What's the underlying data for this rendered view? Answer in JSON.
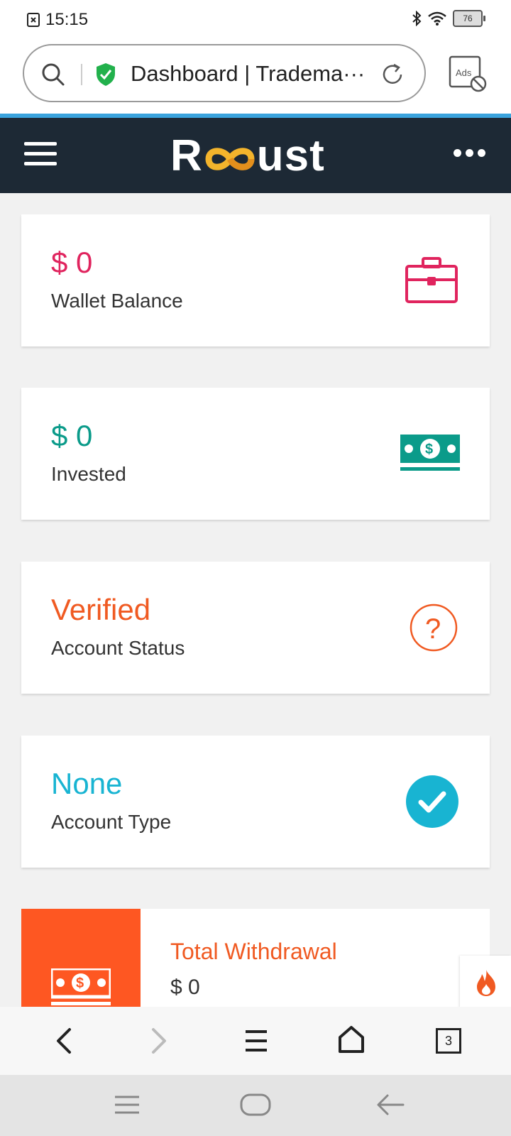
{
  "status_bar": {
    "time": "15:15",
    "battery": "76"
  },
  "browser": {
    "url_text": "Dashboard | Tradema···",
    "ads_label": "Ads",
    "tab_count": "3"
  },
  "site": {
    "logo_text_left": "R",
    "logo_text_right": "ust"
  },
  "cards": [
    {
      "value": "$ 0",
      "label": "Wallet Balance",
      "color": "#e0245e",
      "icon": "briefcase-icon"
    },
    {
      "value": "$ 0",
      "label": "Invested",
      "color": "#0b9b8a",
      "icon": "money-icon"
    },
    {
      "value": "Verified",
      "label": "Account Status",
      "color": "#f05a22",
      "icon": "question-circle-icon"
    },
    {
      "value": "None",
      "label": "Account Type",
      "color": "#18b4d2",
      "icon": "check-circle-icon"
    }
  ],
  "withdrawal": {
    "title": "Total Withdrawal",
    "value": "$ 0",
    "color": "#fe5722"
  }
}
